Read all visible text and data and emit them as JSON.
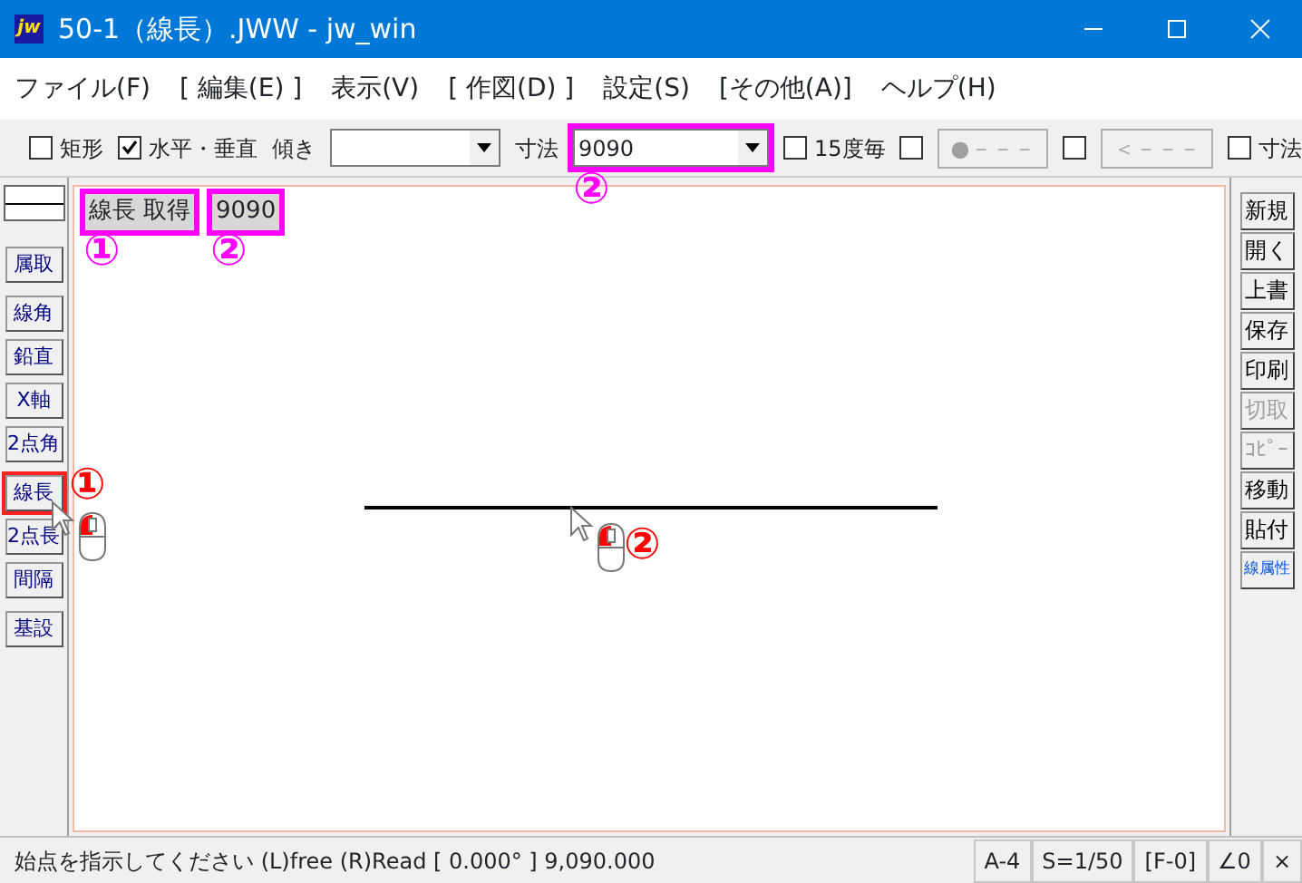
{
  "window": {
    "app_icon": "jw",
    "title": "50-1（線長）.JWW - jw_win"
  },
  "menu": [
    "ファイル(F)",
    "[ 編集(E) ]",
    "表示(V)",
    "[ 作図(D) ]",
    "設定(S)",
    "[その他(A)]",
    "ヘルプ(H)"
  ],
  "toolbar": [
    {
      "kind": "checkbox",
      "label": "矩形",
      "checked": false
    },
    {
      "kind": "checkbox",
      "label": "水平・垂直",
      "checked": true
    },
    {
      "kind": "label",
      "text": "傾き"
    },
    {
      "kind": "combo",
      "highlighted": false
    },
    {
      "kind": "label",
      "text": "寸法"
    },
    {
      "kind": "combo",
      "value": "9090",
      "highlighted": true
    },
    {
      "kind": "checkbox",
      "label": "15度毎",
      "checked": false
    },
    {
      "kind": "checkbox",
      "checked": false
    },
    {
      "kind": "button",
      "label": "●－－－",
      "disabled": true
    },
    {
      "kind": "checkbox",
      "checked": false
    },
    {
      "kind": "button",
      "label": "＜－－－",
      "disabled": true
    },
    {
      "kind": "checkbox",
      "label": "寸法",
      "checked": false
    }
  ],
  "left_tools": [
    {
      "label": "属取",
      "highlighted": false
    },
    {
      "label": "線角",
      "highlighted": false
    },
    {
      "label": "鉛直",
      "highlighted": false
    },
    {
      "label": "X軸",
      "highlighted": false
    },
    {
      "label": "2点角",
      "highlighted": false
    },
    {
      "label": "線長",
      "highlighted": true
    },
    {
      "label": "2点長",
      "highlighted": false
    },
    {
      "label": "間隔",
      "highlighted": false
    },
    {
      "label": "基設",
      "highlighted": false
    }
  ],
  "right_tools": [
    {
      "label": "新規",
      "disabled": false,
      "accent": false
    },
    {
      "label": "開く",
      "disabled": false,
      "accent": false
    },
    {
      "label": "上書",
      "disabled": false,
      "accent": false
    },
    {
      "label": "保存",
      "disabled": false,
      "accent": false
    },
    {
      "label": "印刷",
      "disabled": false,
      "accent": false
    },
    {
      "label": "切取",
      "disabled": true,
      "accent": false
    },
    {
      "label": "ｺﾋﾟｰ",
      "disabled": true,
      "accent": false
    },
    {
      "label": "移動",
      "disabled": false,
      "accent": false
    },
    {
      "label": "貼付",
      "disabled": false,
      "accent": false
    },
    {
      "label": "線属性",
      "disabled": false,
      "accent": true
    }
  ],
  "canvas": {
    "info_boxes": [
      {
        "text": "線長 取得",
        "highlighted": true
      },
      {
        "text": "9090",
        "highlighted": true
      }
    ],
    "annotations": [
      {
        "text": "②",
        "color": "#ff00ff"
      },
      {
        "text": "①",
        "color": "#ff00ff"
      },
      {
        "text": "②",
        "color": "#ff00ff"
      },
      {
        "text": "①",
        "color": "#ff0000"
      },
      {
        "text": "②",
        "color": "#ff0000"
      }
    ]
  },
  "status_bar": {
    "message": "始点を指示してください (L)free (R)Read [ 0.000° ] 9,090.000",
    "panels": [
      "A-4",
      "S=1/50",
      "[F-0]",
      "∠0",
      "×"
    ]
  }
}
